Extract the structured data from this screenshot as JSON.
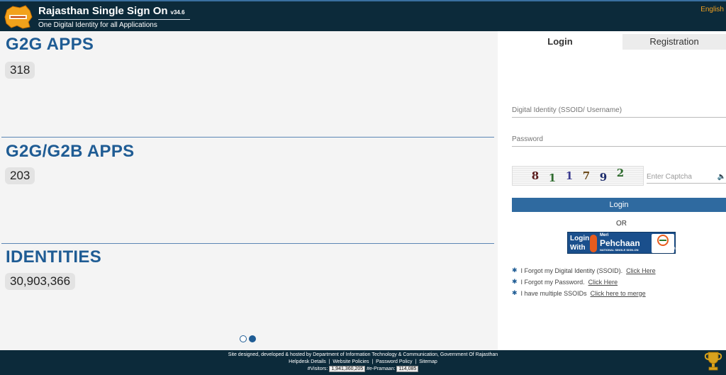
{
  "header": {
    "title": "Rajasthan Single Sign On",
    "version": "v34.6",
    "subtitle": "One Digital Identity for all Applications",
    "language_link": "English"
  },
  "stats": [
    {
      "label": "G2G APPS",
      "value": "318"
    },
    {
      "label": "G2G/G2B APPS",
      "value": "203"
    },
    {
      "label": "IDENTITIES",
      "value": "30,903,366"
    }
  ],
  "carousel": {
    "slides": 2,
    "active_index": 1
  },
  "login": {
    "tabs": {
      "login": "Login",
      "registration": "Registration"
    },
    "username_placeholder": "Digital Identity (SSOID/ Username)",
    "password_placeholder": "Password",
    "captcha_digits": [
      "8",
      "1",
      "1",
      "7",
      "9",
      "2"
    ],
    "captcha_placeholder": "Enter Captcha",
    "login_button": "Login",
    "or_text": "OR",
    "meri_pehchaan": {
      "login": "Login",
      "with": "With",
      "meri": "Meri",
      "pehchaan": "Pehchaan",
      "tagline": "NATIONAL SINGLE SIGN-ON",
      "epramaan": "e-Pramaan"
    },
    "links": [
      {
        "text": "I Forgot my Digital Identity (SSOID).",
        "link": "Click Here"
      },
      {
        "text": "I Forgot my Password.",
        "link": "Click Here"
      },
      {
        "text": "I have multiple SSOIDs",
        "link": "Click here to merge"
      }
    ]
  },
  "footer": {
    "credit": "Site designed, developed & hosted by Department of Information Technology & Communication, Government Of Rajasthan",
    "links": [
      "Helpdesk Details",
      "Website Policies",
      "Password Policy",
      "Sitemap"
    ],
    "visitors_label": "#Visitors:",
    "visitors_count": "1,941,360,205",
    "epramaan_label": "#e-Pramaan:",
    "epramaan_count": "114,085"
  },
  "colors": {
    "header_bg": "#0c2a3a",
    "accent_blue": "#1f5c94",
    "button_blue": "#2f6aa0",
    "lang_orange": "#f0a020"
  }
}
